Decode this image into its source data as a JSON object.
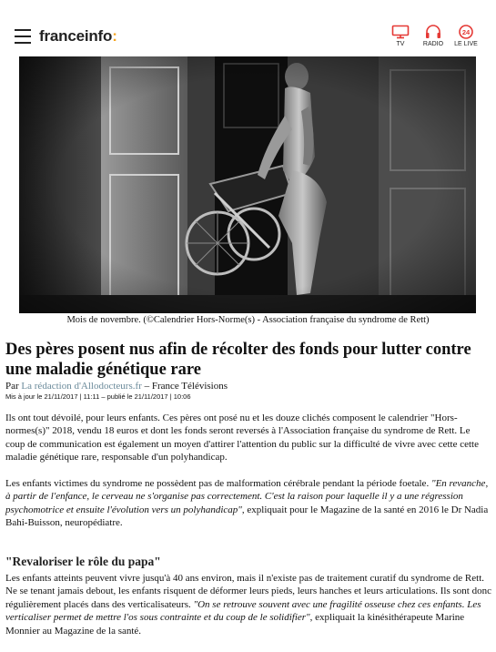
{
  "header": {
    "logo_main": "franceinfo",
    "logo_colon": ":",
    "nav": [
      {
        "label": "TV",
        "icon": "tv-icon"
      },
      {
        "label": "RADIO",
        "icon": "headphones-icon"
      },
      {
        "label": "LE LIVE",
        "icon": "live-24-icon",
        "badge": "24"
      }
    ],
    "accent_color": "#e53935"
  },
  "photo": {
    "caption": "Mois de novembre. (©Calendrier Hors-Norme(s) - Association française du syndrome de Rett)"
  },
  "article": {
    "title": "Des pères posent nus afin de récolter des fonds pour lutter contre une maladie génétique rare",
    "byline_prefix": "Par ",
    "author": "La rédaction d'Allodocteurs.fr",
    "byline_suffix": " – France Télévisions",
    "dates": "Mis à jour le 21/11/2017 | 11:11 – publié le 21/11/2017 | 10:06",
    "p1": "Ils ont tout dévoilé, pour leurs enfants. Ces pères ont posé nu et les douze clichés composent le calendrier \"Hors-normes(s)\" 2018, vendu 18 euros et dont les fonds seront reversés à l'Association française du syndrome de Rett. Le coup de communication est également un moyen d'attirer l'attention du public sur la difficulté de vivre avec cette cette maladie génétique rare, responsable d'un polyhandicap.",
    "p2_a": "Les enfants victimes du syndrome ne possèdent pas de malformation cérébrale pendant la période foetale. ",
    "p2_quote": "\"En revanche, à partir de l'enfance, le cerveau ne s'organise pas correctement. C'est la raison pour laquelle il y a une régression psychomotrice et ensuite l'évolution vers un polyhandicap\"",
    "p2_b": ", expliquait pour le Magazine de la santé en 2016 le Dr Nadia Bahi-Buisson, neuropédiatre.",
    "subhead": "\"Revaloriser le rôle du papa\"",
    "p3_a": "Les enfants atteints peuvent vivre jusqu'à 40 ans environ, mais il n'existe pas de traitement curatif du syndrome de Rett. Ne se tenant jamais debout, les enfants risquent de déformer leurs pieds, leurs hanches et leurs articulations. Ils sont donc régulièrement placés dans des verticalisateurs. ",
    "p3_quote": "\"On se retrouve souvent avec une fragilité osseuse chez ces enfants. Les verticaliser permet de mettre l'os sous contrainte et du coup de le solidifier\"",
    "p3_b": ", expliquait la kinésithérapeute Marine Monnier au Magazine de la santé."
  }
}
